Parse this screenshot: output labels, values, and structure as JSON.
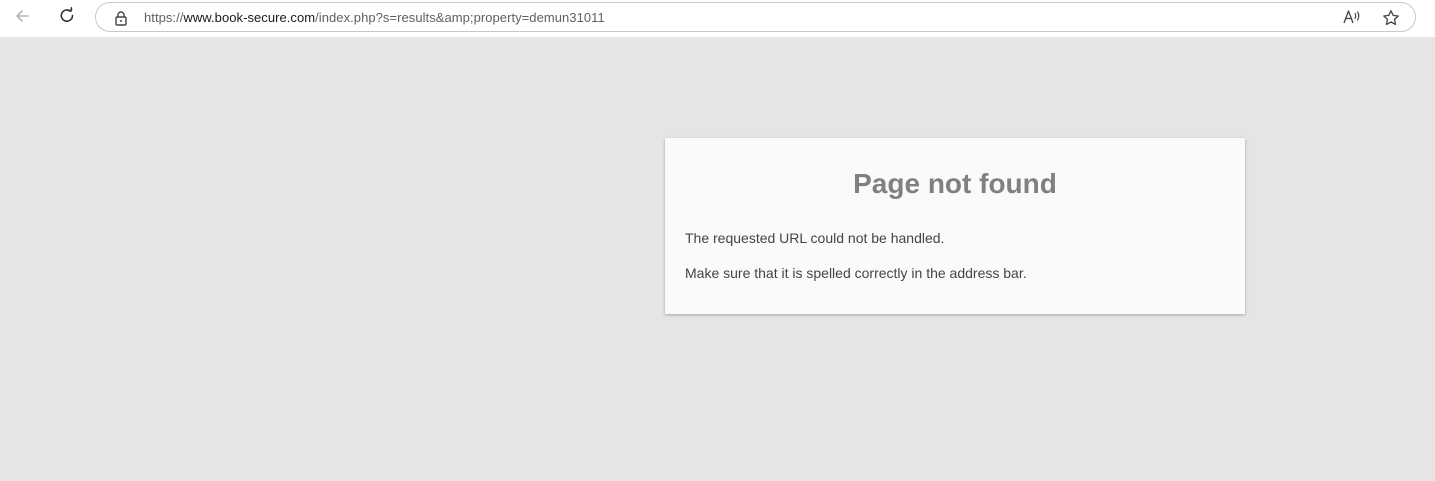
{
  "browser": {
    "url_prefix": "https://",
    "url_host": "www.book-secure.com",
    "url_path": "/index.php?s=results&amp;property=demun31011",
    "icons": {
      "back": "arrow-left-icon",
      "reload": "reload-icon",
      "lock": "lock-icon",
      "read_aloud": "read-aloud-icon",
      "favorite": "star-icon"
    }
  },
  "page": {
    "title": "Page not found",
    "message_1": "The requested URL could not be handled.",
    "message_2": "Make sure that it is spelled correctly in the address bar."
  },
  "colors": {
    "page_background": "#e5e5e5",
    "card_background": "#fafafa",
    "title_color": "#808080",
    "text_color": "#444444"
  }
}
